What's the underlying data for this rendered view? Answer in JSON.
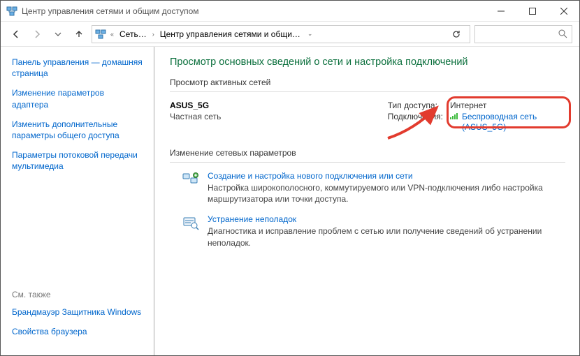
{
  "window": {
    "title": "Центр управления сетями и общим доступом"
  },
  "breadcrumb": {
    "root": "Сеть…",
    "section": "Центр управления сетями и общи…"
  },
  "sidebar": {
    "links": [
      "Панель управления — домашняя страница",
      "Изменение параметров адаптера",
      "Изменить дополнительные параметры общего доступа",
      "Параметры потоковой передачи мультимедиа"
    ],
    "seeAlsoLabel": "См. также",
    "bottomLinks": [
      "Брандмауэр Защитника Windows",
      "Свойства браузера"
    ]
  },
  "content": {
    "pageTitle": "Просмотр основных сведений о сети и настройка подключений",
    "activeNetworksLabel": "Просмотр активных сетей",
    "network": {
      "name": "ASUS_5G",
      "profile": "Частная сеть",
      "accessTypeLabel": "Тип доступа:",
      "accessTypeValue": "Интернет",
      "connectionsLabel": "Подключения:",
      "connectionLink": "Беспроводная сеть (ASUS_5G)"
    },
    "changeSettingsLabel": "Изменение сетевых параметров",
    "items": [
      {
        "link": "Создание и настройка нового подключения или сети",
        "desc": "Настройка широкополосного, коммутируемого или VPN-подключения либо настройка маршрутизатора или точки доступа."
      },
      {
        "link": "Устранение неполадок",
        "desc": "Диагностика и исправление проблем с сетью или получение сведений об устранении неполадок."
      }
    ]
  }
}
